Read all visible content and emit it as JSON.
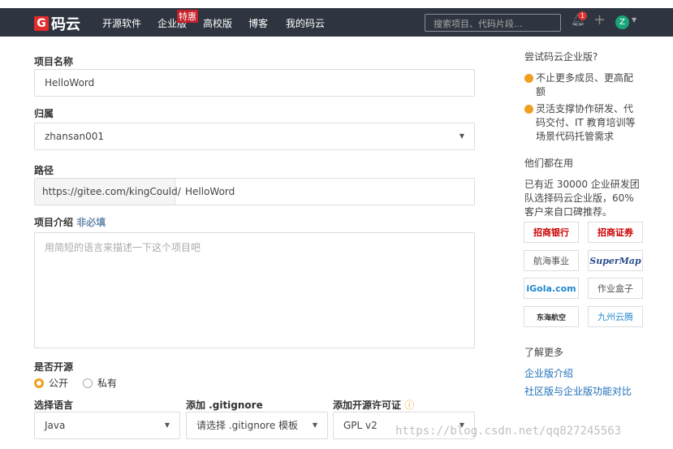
{
  "header": {
    "logo": "码云",
    "logo_mark": "G",
    "nav": [
      "开源软件",
      "企业版",
      "高校版",
      "博客",
      "我的码云"
    ],
    "badge": "特惠",
    "search_placeholder": "搜索项目、代码片段...",
    "notifications": "1",
    "avatar": "Z"
  },
  "form": {
    "name_label": "项目名称",
    "name_value": "HelloWord",
    "owner_label": "归属",
    "owner_value": "zhansan001",
    "path_label": "路径",
    "path_prefix": "https://gitee.com/kingCould/",
    "path_value": "HelloWord",
    "desc_label": "项目介绍",
    "desc_optional": "非必填",
    "desc_placeholder": "用简短的语言来描述一下这个项目吧",
    "open_label": "是否开源",
    "open_options": [
      "公开",
      "私有"
    ],
    "open_selected": "公开",
    "lang_label": "选择语言",
    "lang_value": "Java",
    "gitignore_label": "添加 .gitignore",
    "gitignore_value": "请选择 .gitignore 模板",
    "license_label": "添加开源许可证",
    "license_value": "GPL v2"
  },
  "sidebar": {
    "try_title": "尝试码云企业版?",
    "points": [
      "不止更多成员、更高配额",
      "灵活支撑协作研发、代码交付、IT 教育培训等场景代码托管需求"
    ],
    "users_title": "他们都在用",
    "users_text": "已有近 30000 企业研发团队选择码云企业版，60% 客户来自口碑推荐。",
    "logos": [
      "招商银行",
      "招商证券",
      "航海事业",
      "SuperMap",
      "iGola.com",
      "作业盒子",
      "东海航空",
      "九州云腾"
    ],
    "more_title": "了解更多",
    "links": [
      "企业版介绍",
      "社区版与企业版功能对比"
    ]
  },
  "watermark": "https://blog.csdn.net/qq827245563"
}
